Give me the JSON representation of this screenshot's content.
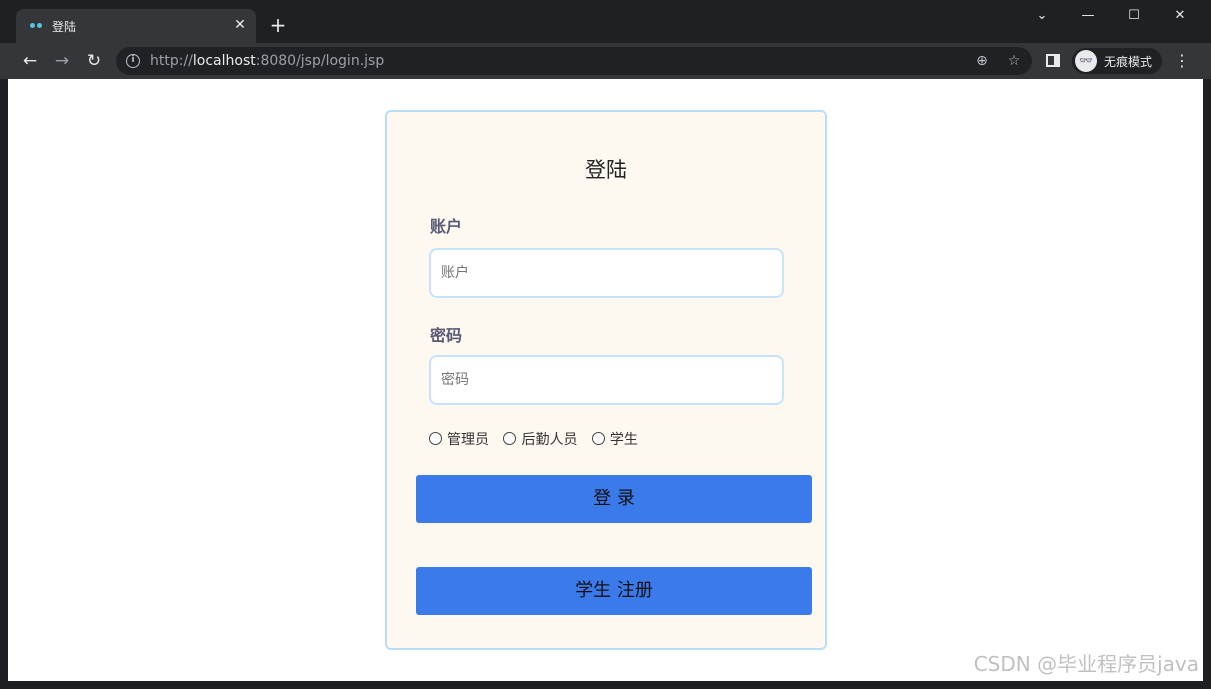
{
  "browser": {
    "tab": {
      "title": "登陆",
      "close_glyph": "✕",
      "favicon": "two-dot-icon"
    },
    "new_tab_glyph": "+",
    "window_controls": {
      "collapse": "⌄",
      "minimize": "—",
      "maximize": "☐",
      "close": "✕"
    },
    "nav": {
      "back": "←",
      "forward": "→",
      "reload": "↻"
    },
    "url": {
      "scheme": "http://",
      "host": "localhost",
      "rest": ":8080/jsp/login.jsp"
    },
    "omnibox_icons": {
      "zoom": "⊕",
      "bookmark": "☆"
    },
    "incognito_label": "无痕模式",
    "incognito_avatar": "👓",
    "menu_glyph": "⋮",
    "colors": {
      "tabbar": "#1f2023",
      "toolbar": "#35363a",
      "omnibox": "#202124"
    }
  },
  "login": {
    "title": "登陆",
    "account_label": "账户",
    "account_placeholder": "账户",
    "password_label": "密码",
    "password_placeholder": "密码",
    "roles": [
      {
        "label": "管理员",
        "selected": false
      },
      {
        "label": "后勤人员",
        "selected": false
      },
      {
        "label": "学生",
        "selected": false
      }
    ],
    "login_button": "登 录",
    "register_button": "学生 注册",
    "colors": {
      "card_bg": "#fdf9f0",
      "card_border": "#b9dcfa",
      "button": "#3b7aeb",
      "label": "#5a5a78"
    }
  },
  "watermark": "CSDN @毕业程序员java"
}
